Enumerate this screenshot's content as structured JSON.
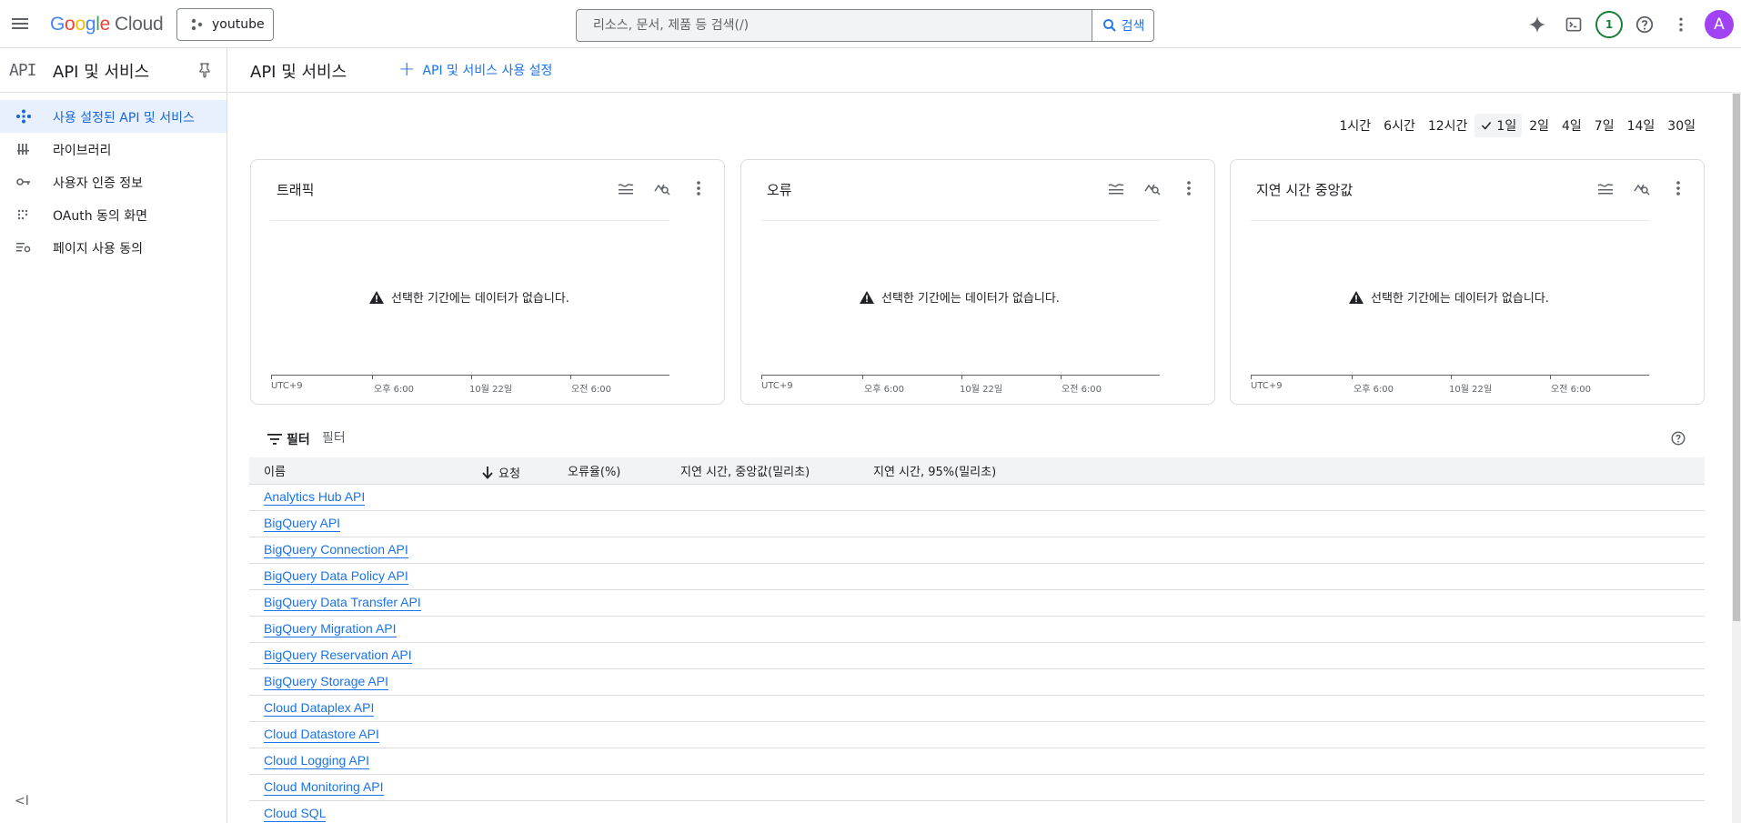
{
  "topbar": {
    "logo": {
      "g1": "G",
      "g2": "o",
      "g3": "o",
      "g4": "g",
      "g5": "l",
      "g6": "e",
      "cloud": "Cloud"
    },
    "project": "youtube",
    "search_placeholder": "리소스, 문서, 제품 등 검색(/)",
    "search_button": "검색",
    "notification_count": "1",
    "avatar_letter": "A"
  },
  "sidebar": {
    "logo_text": "API",
    "title": "API 및 서비스",
    "items": [
      {
        "label": "사용 설정된 API 및 서비스",
        "icon": "api-diamond-icon",
        "active": true
      },
      {
        "label": "라이브러리",
        "icon": "library-icon",
        "active": false
      },
      {
        "label": "사용자 인증 정보",
        "icon": "key-icon",
        "active": false
      },
      {
        "label": "OAuth 동의 화면",
        "icon": "oauth-dots-icon",
        "active": false
      },
      {
        "label": "페이지 사용 동의",
        "icon": "list-settings-icon",
        "active": false
      }
    ],
    "collapse_label": "<I"
  },
  "main": {
    "title": "API 및 서비스",
    "enable_button": "API 및 서비스 사용 설정"
  },
  "time_range": {
    "options": [
      "1시간",
      "6시간",
      "12시간",
      "1일",
      "2일",
      "4일",
      "7일",
      "14일",
      "30일"
    ],
    "selected": "1일"
  },
  "charts": [
    {
      "title": "트래픽",
      "no_data": "선택한 기간에는 데이터가 없습니다.",
      "ticks": [
        "UTC+9",
        "오후 6:00",
        "10월 22일",
        "오전 6:00"
      ]
    },
    {
      "title": "오류",
      "no_data": "선택한 기간에는 데이터가 없습니다.",
      "ticks": [
        "UTC+9",
        "오후 6:00",
        "10월 22일",
        "오전 6:00"
      ]
    },
    {
      "title": "지연 시간 중앙값",
      "no_data": "선택한 기간에는 데이터가 없습니다.",
      "ticks": [
        "UTC+9",
        "오후 6:00",
        "10월 22일",
        "오전 6:00"
      ]
    }
  ],
  "table": {
    "filter_label": "필터",
    "filter_placeholder": "필터",
    "columns": [
      "이름",
      "요청",
      "오류율(%)",
      "지연 시간, 중앙값(밀리초)",
      "지연 시간, 95%(밀리초)"
    ],
    "rows": [
      "Analytics Hub API",
      "BigQuery API",
      "BigQuery Connection API",
      "BigQuery Data Policy API",
      "BigQuery Data Transfer API",
      "BigQuery Migration API",
      "BigQuery Reservation API",
      "BigQuery Storage API",
      "Cloud Dataplex API",
      "Cloud Datastore API",
      "Cloud Logging API",
      "Cloud Monitoring API",
      "Cloud SQL"
    ]
  },
  "colors": {
    "accent": "#1a73e8",
    "active_bg": "#e8f0fe",
    "notif": "#188038",
    "avatar": "#a142f4"
  }
}
